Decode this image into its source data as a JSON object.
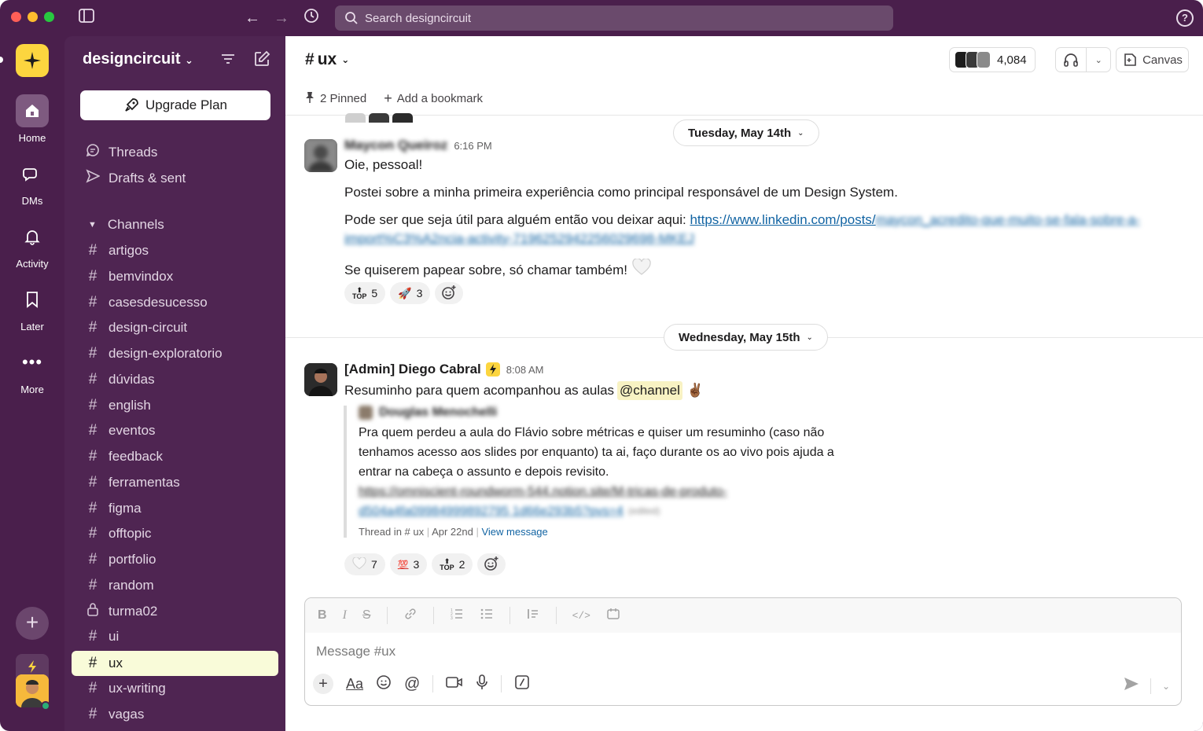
{
  "search": {
    "placeholder": "Search designcircuit"
  },
  "rail": {
    "items": [
      {
        "label": "Home"
      },
      {
        "label": "DMs"
      },
      {
        "label": "Activity"
      },
      {
        "label": "Later"
      },
      {
        "label": "More"
      }
    ]
  },
  "workspace": {
    "name": "designcircuit",
    "upgrade_label": "Upgrade Plan"
  },
  "sidebar": {
    "nav": [
      {
        "label": "Threads"
      },
      {
        "label": "Drafts & sent"
      }
    ],
    "channels_header": "Channels",
    "channels": [
      {
        "name": "artigos",
        "icon": "#"
      },
      {
        "name": "bemvindox",
        "icon": "#"
      },
      {
        "name": "casesdesucesso",
        "icon": "#"
      },
      {
        "name": "design-circuit",
        "icon": "#"
      },
      {
        "name": "design-exploratorio",
        "icon": "#"
      },
      {
        "name": "dúvidas",
        "icon": "#"
      },
      {
        "name": "english",
        "icon": "#"
      },
      {
        "name": "eventos",
        "icon": "#"
      },
      {
        "name": "feedback",
        "icon": "#"
      },
      {
        "name": "ferramentas",
        "icon": "#"
      },
      {
        "name": "figma",
        "icon": "#"
      },
      {
        "name": "offtopic",
        "icon": "#"
      },
      {
        "name": "portfolio",
        "icon": "#"
      },
      {
        "name": "random",
        "icon": "#"
      },
      {
        "name": "turma02",
        "icon": "lock"
      },
      {
        "name": "ui",
        "icon": "#"
      },
      {
        "name": "ux",
        "icon": "#",
        "active": true
      },
      {
        "name": "ux-writing",
        "icon": "#"
      },
      {
        "name": "vagas",
        "icon": "#"
      }
    ]
  },
  "header": {
    "channel": "ux",
    "member_count": "4,084",
    "canvas_label": "Canvas",
    "pinned_label": "2 Pinned",
    "bookmark_label": "Add a bookmark"
  },
  "messages": [
    {
      "date": "Tuesday, May 14th",
      "author": "Maycon Queiroz",
      "time": "6:16 PM",
      "lines": [
        "Oie, pessoal!",
        "Postei sobre a minha primeira experiência como principal responsável de um Design System.",
        "Pode ser que seja útil para alguém então vou deixar aqui: "
      ],
      "link_visible": "https://www.linkedin.com/posts/",
      "link_blurred_1": "maycon_acredito-que-muito-se-fala-sobre-a-",
      "link_blurred_2": "import%C3%A2ncia-activity-7196252942256029698-MKEJ",
      "last_line": "Se quiserem papear sobre, só chamar também!",
      "reactions": [
        {
          "emoji": "top",
          "count": "5"
        },
        {
          "emoji": "rocket",
          "count": "3"
        }
      ]
    },
    {
      "date": "Wednesday, May 15th",
      "author": "[Admin] Diego Cabral",
      "time": "8:08 AM",
      "text": "Resuminho para quem acompanhou as aulas ",
      "mention": "@channel",
      "quote": {
        "author": "Douglas Menochelli",
        "text_1": "Pra quem perdeu a aula do Flávio sobre métricas e quiser um resuminho (caso não",
        "text_2": "tenhamos acesso aos slides por enquanto) ta ai, faço durante os ao vivo pois ajuda a",
        "text_3": "entrar na cabeça o assunto e depois revisito.",
        "link_1": "https://omniscient-roundworm-544.notion.site/M-tricas-de-produto-",
        "link_2": "d504a4fa09984999892795 1d66e293b5?pvs=4",
        "edited": "(edited)",
        "meta_prefix": "Thread in",
        "meta_channel": "ux",
        "meta_date": "Apr 22nd",
        "view": "View message"
      },
      "reactions": [
        {
          "emoji": "heart",
          "count": "7"
        },
        {
          "emoji": "100",
          "count": "3"
        },
        {
          "emoji": "top",
          "count": "2"
        }
      ]
    }
  ],
  "composer": {
    "placeholder": "Message #ux"
  },
  "colors": {
    "aubergine": "#4a1f4c",
    "active": "#f9fbd9",
    "link": "#1264a3"
  }
}
